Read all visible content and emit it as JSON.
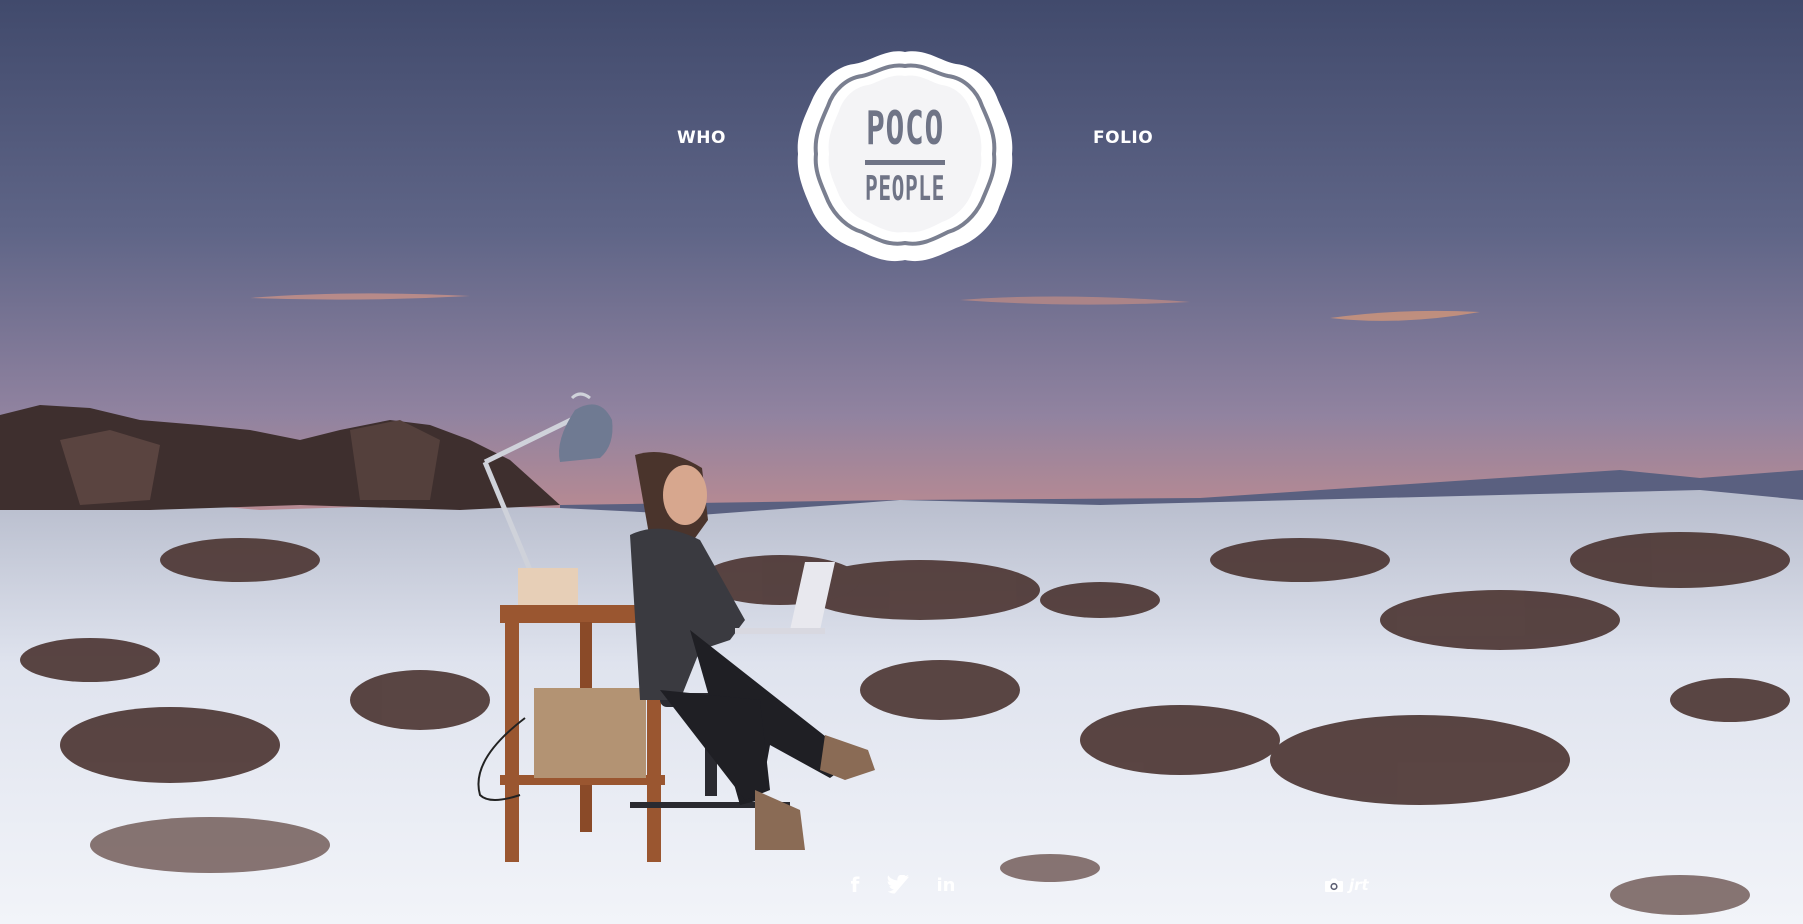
{
  "nav": {
    "who_label": "WHO",
    "folio_label": "FOLIO"
  },
  "logo": {
    "line1": "POCO",
    "line2": "PEOPLE"
  },
  "social": {
    "facebook_icon": "facebook-icon",
    "facebook_glyph": "f",
    "twitter_icon": "twitter-icon",
    "linkedin_icon": "linkedin-icon",
    "linkedin_glyph": "in"
  },
  "photo_credit": {
    "icon": "camera-icon",
    "text": "jrt"
  },
  "colors": {
    "sky_top": "#4a5170",
    "sky_mid": "#8a7c98",
    "horizon": "#f0955e",
    "snow": "#e8ecf4",
    "logo_ink": "#6f7486"
  }
}
